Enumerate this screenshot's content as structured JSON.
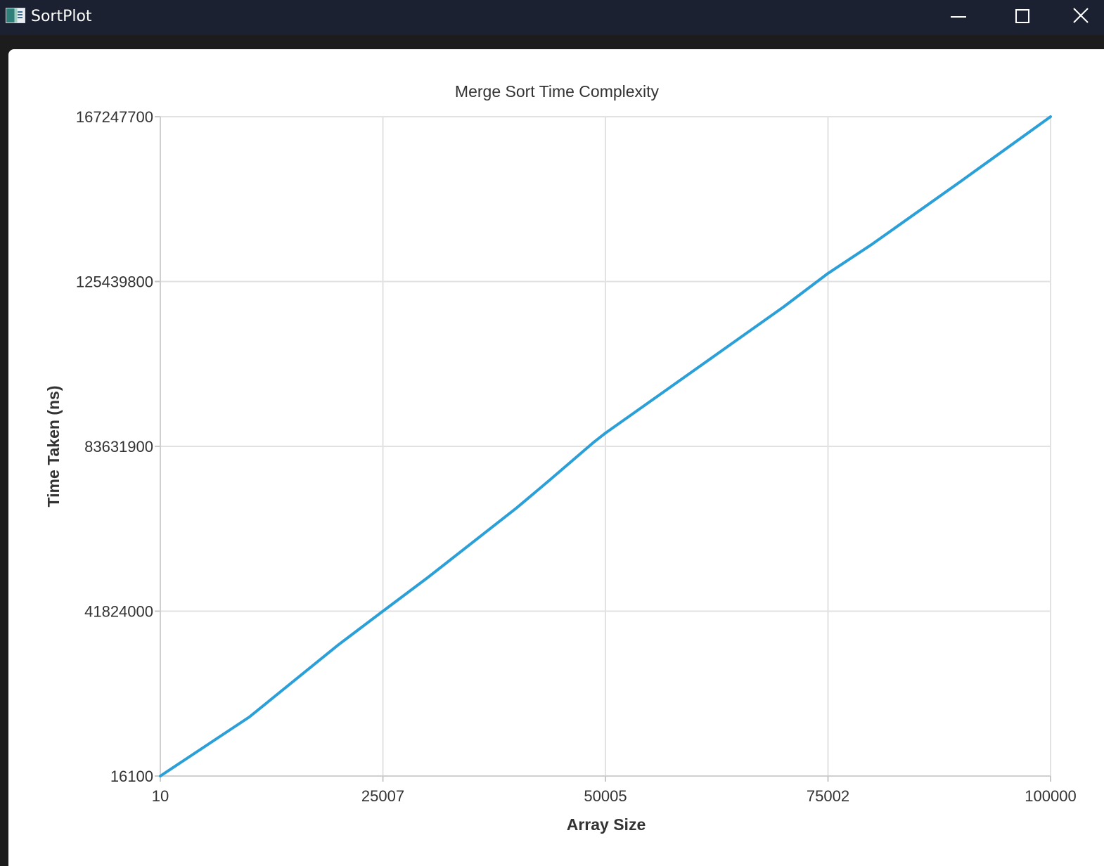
{
  "window": {
    "title": "SortPlot",
    "icon": "chart-app-icon",
    "controls": [
      "minimize-icon",
      "maximize-icon",
      "close-icon"
    ]
  },
  "chart_data": {
    "type": "line",
    "title": "Merge Sort Time Complexity",
    "xlabel": "Array Size",
    "ylabel": "Time Taken (ns)",
    "xlim": [
      10,
      100000
    ],
    "ylim": [
      16100,
      167247700
    ],
    "x_ticks": [
      "10",
      "25007",
      "50005",
      "75002",
      "100000"
    ],
    "y_ticks": [
      "16100",
      "41824000",
      "83631900",
      "125439800",
      "167247700"
    ],
    "grid": true,
    "legend": "none",
    "line_color": "#2b9fd8",
    "series": [
      {
        "x": [
          10,
          10010,
          20010,
          25007,
          30010,
          40010,
          43700,
          48600,
          50005,
          60010,
          70010,
          75002,
          80010,
          90010,
          100000
        ],
        "y": [
          16100,
          15000000,
          33300000,
          41824000,
          50300000,
          68000000,
          75000000,
          84500000,
          87000000,
          103000000,
          119000000,
          127500000,
          135000000,
          151000000,
          167247700
        ]
      }
    ]
  }
}
